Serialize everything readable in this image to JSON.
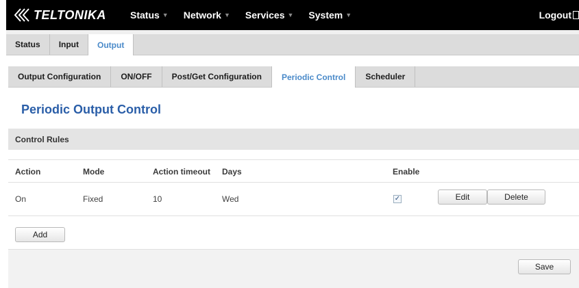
{
  "app": {
    "brand": "TELTONIKA",
    "menu": [
      {
        "label": "Status"
      },
      {
        "label": "Network"
      },
      {
        "label": "Services"
      },
      {
        "label": "System"
      }
    ],
    "logout_label": "Logout"
  },
  "tabs_level1": [
    {
      "label": "Status",
      "active": false
    },
    {
      "label": "Input",
      "active": false
    },
    {
      "label": "Output",
      "active": true
    }
  ],
  "tabs_level2": [
    {
      "label": "Output Configuration",
      "active": false
    },
    {
      "label": "ON/OFF",
      "active": false
    },
    {
      "label": "Post/Get Configuration",
      "active": false
    },
    {
      "label": "Periodic Control",
      "active": true
    },
    {
      "label": "Scheduler",
      "active": false
    }
  ],
  "page_title": "Periodic Output Control",
  "section_title": "Control Rules",
  "table": {
    "headers": {
      "action": "Action",
      "mode": "Mode",
      "timeout": "Action timeout",
      "days": "Days",
      "enable": "Enable"
    },
    "rows": [
      {
        "action": "On",
        "mode": "Fixed",
        "timeout": "10",
        "days": "Wed",
        "enabled": true,
        "edit_label": "Edit",
        "delete_label": "Delete"
      }
    ]
  },
  "buttons": {
    "add_label": "Add",
    "save_label": "Save"
  },
  "colors": {
    "accent": "#4a8ac9",
    "title": "#2a5ea8",
    "topbar": "#000000"
  }
}
